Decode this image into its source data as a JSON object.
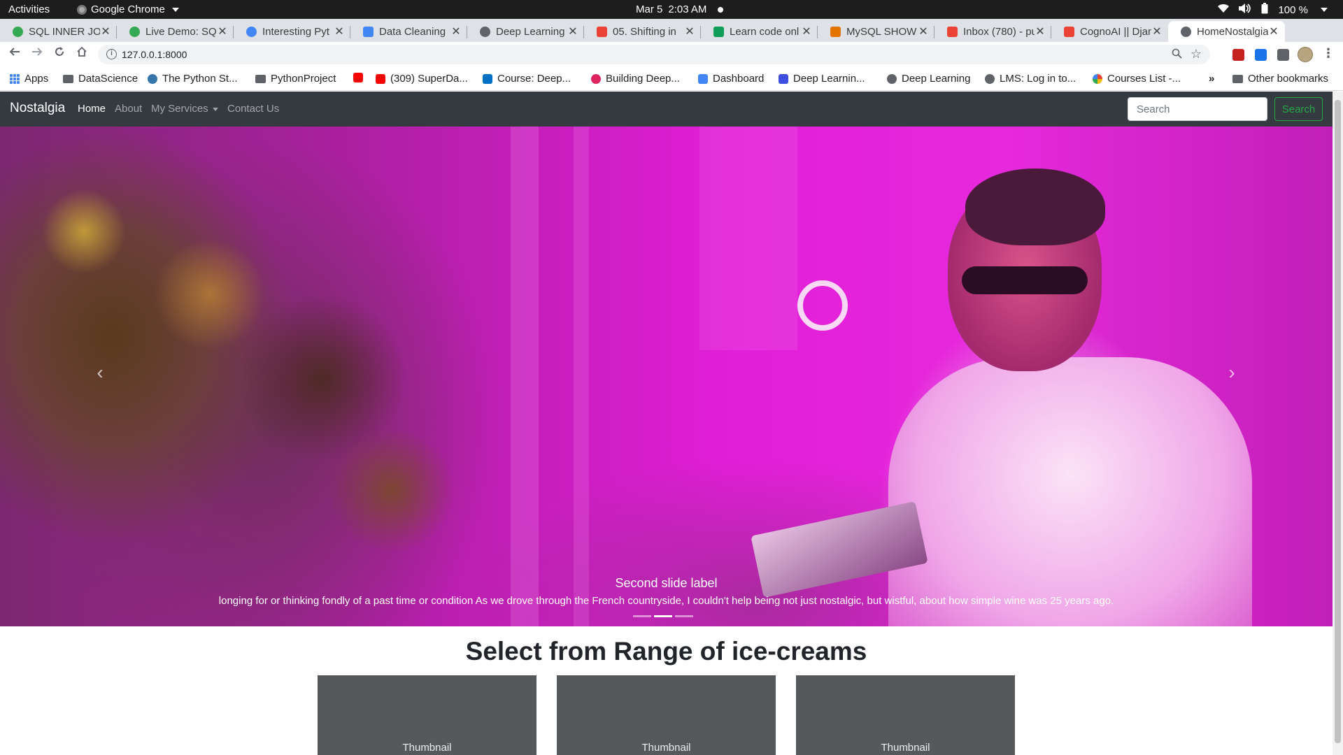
{
  "system_bar": {
    "activities": "Activities",
    "app_name": "Google Chrome",
    "date": "Mar 5",
    "time": "2:03 AM",
    "battery": "100 %"
  },
  "tabs": [
    {
      "title": "SQL INNER JOI",
      "color": "#34a853"
    },
    {
      "title": "Live Demo: SQ",
      "color": "#34a853"
    },
    {
      "title": "Interesting Pyt",
      "color": "#4285f4"
    },
    {
      "title": "Data Cleaning",
      "color": "#4285f4"
    },
    {
      "title": "Deep Learning",
      "color": "#5f6368"
    },
    {
      "title": "05. Shifting in",
      "color": "#ea4335"
    },
    {
      "title": "Learn code onl",
      "color": "#0f9d58"
    },
    {
      "title": "MySQL SHOW",
      "color": "#ea4335"
    },
    {
      "title": "Inbox (780) - pu",
      "color": "#ea4335"
    },
    {
      "title": "CognoAI || Djan",
      "color": "#ea4335"
    },
    {
      "title": "HomeNostalgia",
      "color": "#5f6368"
    }
  ],
  "toolbar": {
    "url": "127.0.0.1:8000"
  },
  "bookmarks": [
    {
      "label": "Apps",
      "icon": "apps-grid-icon"
    },
    {
      "label": "DataScience",
      "icon": "folder-icon"
    },
    {
      "label": "The Python St...",
      "icon": "python-icon"
    },
    {
      "label": "PythonProject",
      "icon": "folder-icon"
    },
    {
      "label": "",
      "icon": "youtube-icon"
    },
    {
      "label": "(309) SuperDa...",
      "icon": "youtube-icon"
    },
    {
      "label": "Course: Deep...",
      "icon": "intel-icon"
    },
    {
      "label": "Building Deep...",
      "icon": "red-circle-icon"
    },
    {
      "label": "Dashboard",
      "icon": "blue-square-icon"
    },
    {
      "label": "Deep Learnin...",
      "icon": "s-icon"
    },
    {
      "label": "Deep Learning",
      "icon": "globe-icon"
    },
    {
      "label": "LMS: Log in to...",
      "icon": "globe-icon"
    },
    {
      "label": "Courses List -...",
      "icon": "google-icon"
    },
    {
      "label": "Other bookmarks",
      "icon": "folder-icon"
    }
  ],
  "site": {
    "brand": "Nostalgia",
    "nav": {
      "home": "Home",
      "about": "About",
      "services": "My Services",
      "contact": "Contact Us"
    },
    "search_placeholder": "Search",
    "search_button": "Search",
    "carousel": {
      "slide_label": "Second slide label",
      "slide_text": "longing for or thinking fondly of a past time or condition As we drove through the French countryside, I couldn't help being not just nostalgic, but wistful, about how simple wine was 25 years ago.",
      "active_index": 2,
      "slide_count": 3
    },
    "section_title": "Select from Range of ice-creams",
    "cards": [
      {
        "label": "Thumbnail"
      },
      {
        "label": "Thumbnail"
      },
      {
        "label": "Thumbnail"
      }
    ]
  },
  "colors": {
    "navbar_bg": "#343a40",
    "search_green": "#28a745",
    "card_bg": "#55595c"
  }
}
